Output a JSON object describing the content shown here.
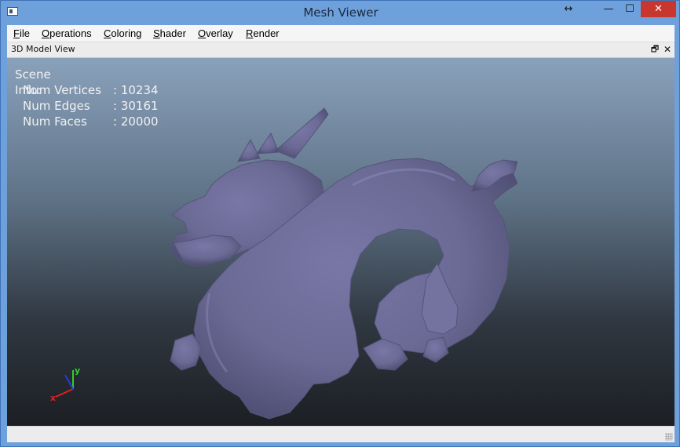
{
  "window": {
    "title": "Mesh Viewer",
    "controls": {
      "resize": "↔",
      "minimize": "—",
      "maximize": "☐",
      "close": "✕"
    }
  },
  "menubar": {
    "items": [
      "File",
      "Operations",
      "Coloring",
      "Shader",
      "Overlay",
      "Render"
    ]
  },
  "dock": {
    "title": "3D Model View",
    "float_glyph": "🗗",
    "close_glyph": "✕"
  },
  "scene_info": {
    "heading": "Scene Info:",
    "rows": [
      {
        "label": "Num Vertices",
        "value": ": 10234"
      },
      {
        "label": "Num Edges",
        "value": ": 30161"
      },
      {
        "label": "Num Faces",
        "value": ": 20000"
      }
    ]
  },
  "axes": {
    "x_label": "x",
    "y_label": "y",
    "x_color": "#e02020",
    "y_color": "#2fd02f",
    "z_color": "#2a3ad8"
  },
  "mesh": {
    "name_icon": "dragon-mesh",
    "color": "#6b6a95"
  },
  "status": {
    "text": ""
  }
}
